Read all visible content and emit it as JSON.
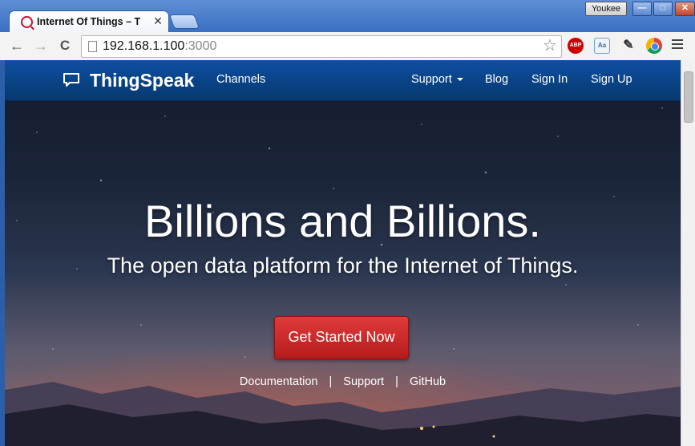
{
  "window": {
    "profile_name": "Youkee",
    "minimize_label": "—",
    "maximize_label": "□",
    "close_label": "✕"
  },
  "tab": {
    "title": "Internet Of Things – T",
    "close_glyph": "✕",
    "favicon": "thingspeak-q-icon"
  },
  "toolbar": {
    "back_glyph": "←",
    "forward_glyph": "→",
    "reload_glyph": "C",
    "url_host": "192.168.1.100",
    "url_port": ":3000",
    "star_glyph": "☆",
    "extensions": {
      "abp": "ABP",
      "dict": "Aa",
      "evernote": "✎"
    }
  },
  "navbar": {
    "brand": "ThingSpeak",
    "channels": "Channels",
    "support": "Support",
    "blog": "Blog",
    "sign_in": "Sign In",
    "sign_up": "Sign Up"
  },
  "hero": {
    "title": "Billions and Billions.",
    "subtitle": "The open data platform for the Internet of Things.",
    "cta": "Get Started Now"
  },
  "footer_links": {
    "documentation": "Documentation",
    "support": "Support",
    "github": "GitHub",
    "separator": "|"
  },
  "colors": {
    "navbar": "#0d4fa0",
    "cta": "#d22a2a",
    "chrome_frame": "#3a6fc1"
  }
}
